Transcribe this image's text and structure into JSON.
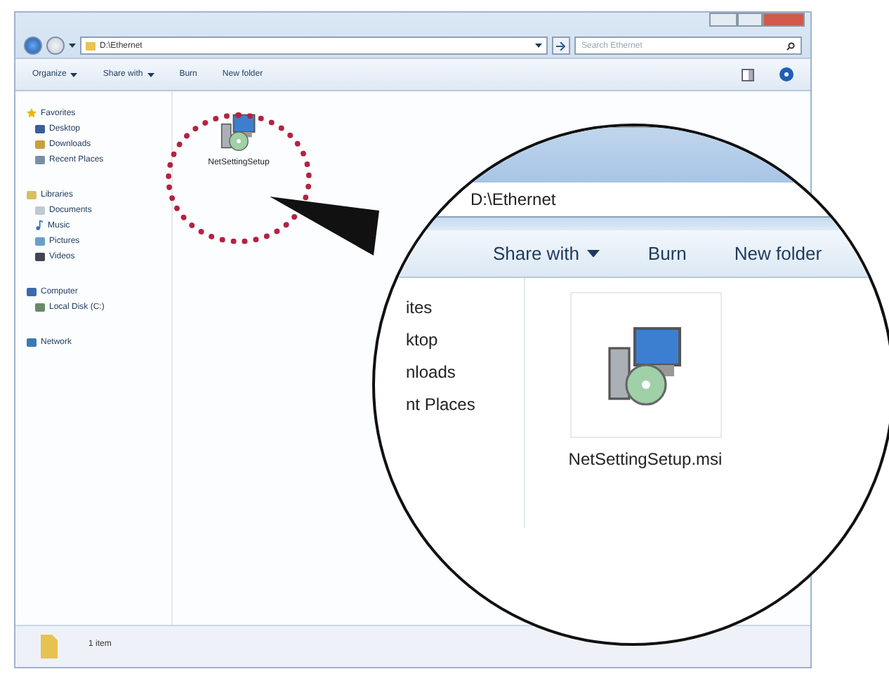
{
  "window": {
    "address": "D:\\Ethernet",
    "search": {
      "placeholder": "Search Ethernet"
    }
  },
  "toolbar": [
    {
      "label": "Organize",
      "has_menu": true
    },
    {
      "label": "Share with",
      "has_menu": true
    },
    {
      "label": "Burn",
      "has_menu": false
    },
    {
      "label": "New folder",
      "has_menu": false
    }
  ],
  "sidebar": [
    {
      "label": "Favorites",
      "children": [
        {
          "label": "Desktop"
        },
        {
          "label": "Downloads"
        },
        {
          "label": "Recent Places"
        }
      ]
    },
    {
      "label": "Libraries",
      "children": [
        {
          "label": "Documents"
        },
        {
          "label": "Music"
        },
        {
          "label": "Pictures"
        },
        {
          "label": "Videos"
        }
      ]
    },
    {
      "label": "Computer",
      "children": [
        {
          "label": "Local Disk (C:)"
        }
      ]
    },
    {
      "label": "Network"
    }
  ],
  "files": [
    {
      "name": "NetSettingSetup"
    }
  ],
  "status_bar": {
    "count": "1 item"
  },
  "magnifier": {
    "address": "D:\\Ethernet",
    "toolbar": [
      {
        "label": "Share with",
        "has_menu": true
      },
      {
        "label": "Burn",
        "has_menu": false
      },
      {
        "label": "New folder",
        "has_menu": false
      }
    ],
    "sidebar": [
      "ites",
      "ktop",
      "nloads",
      "nt Places"
    ],
    "file": {
      "name": "NetSettingSetup.msi"
    }
  }
}
